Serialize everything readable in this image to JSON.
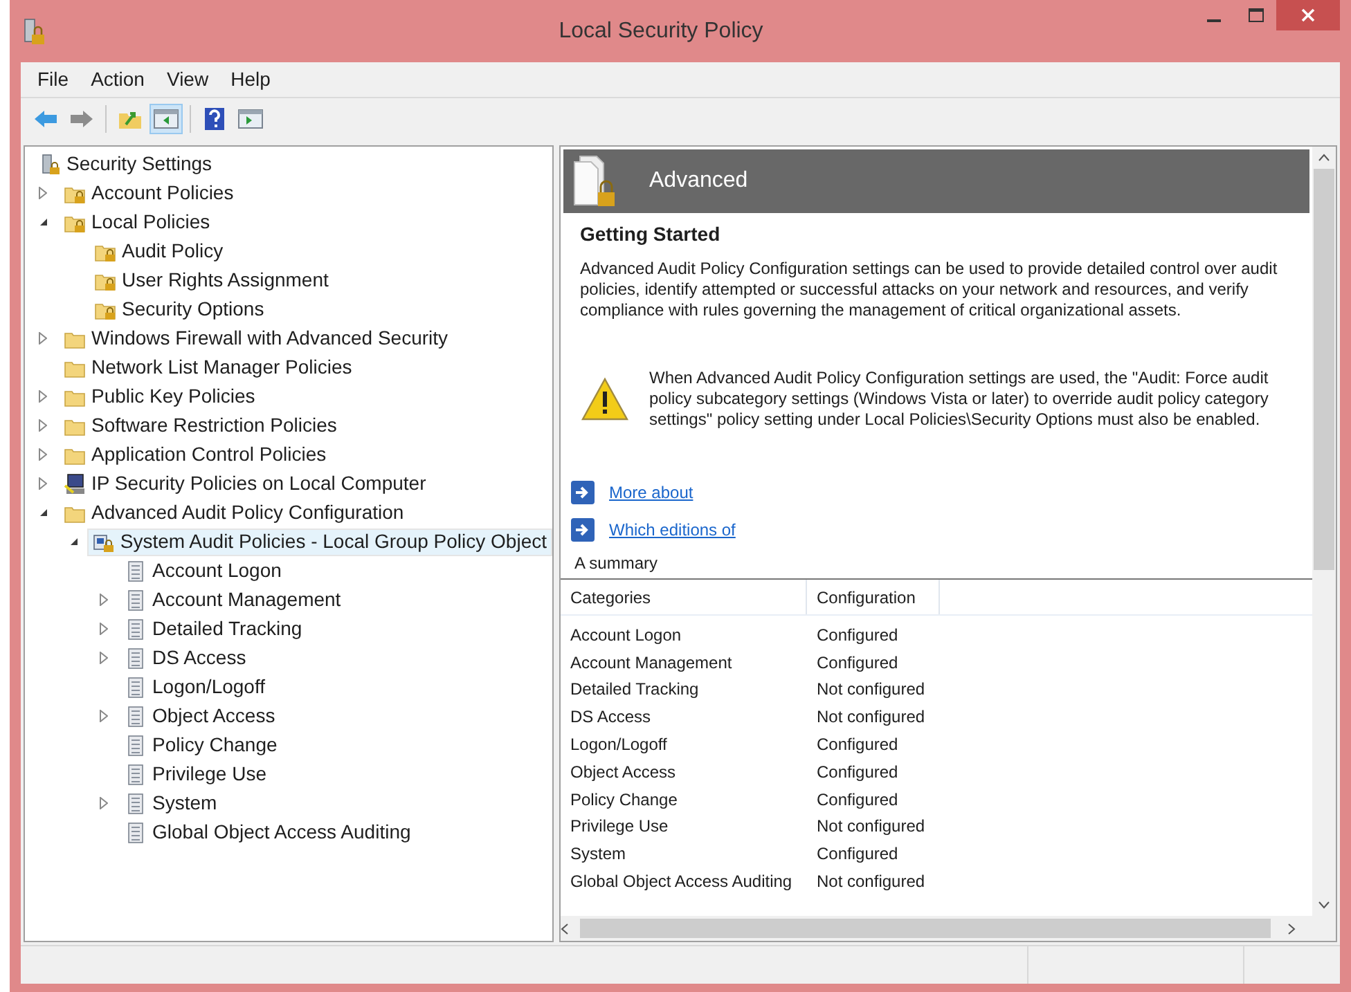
{
  "window": {
    "title": "Local Security Policy"
  },
  "menu": [
    "File",
    "Action",
    "View",
    "Help"
  ],
  "toolbar": [
    {
      "kind": "back",
      "selected": false
    },
    {
      "kind": "forward",
      "selected": false
    },
    {
      "kind": "up",
      "selected": false
    },
    {
      "kind": "pane",
      "selected": true
    },
    {
      "kind": "help",
      "selected": false
    },
    {
      "kind": "action-pane",
      "selected": false
    }
  ],
  "tree": [
    {
      "label": "Security Settings",
      "kind": "root",
      "selected": false,
      "children": [
        {
          "label": "Account Policies",
          "kind": "lock-folder",
          "expanded": false,
          "selected": false
        },
        {
          "label": "Local Policies",
          "kind": "lock-folder",
          "expanded": true,
          "selected": false,
          "children": [
            {
              "label": "Audit Policy",
              "kind": "lock-folder",
              "selected": false
            },
            {
              "label": "User Rights Assignment",
              "kind": "lock-folder",
              "selected": false
            },
            {
              "label": "Security Options",
              "kind": "lock-folder",
              "selected": false
            }
          ]
        },
        {
          "label": "Windows Firewall with Advanced Security",
          "kind": "folder",
          "expanded": false,
          "selected": false
        },
        {
          "label": "Network List Manager Policies",
          "kind": "folder",
          "selected": false
        },
        {
          "label": "Public Key Policies",
          "kind": "folder",
          "expanded": false,
          "selected": false
        },
        {
          "label": "Software Restriction Policies",
          "kind": "folder",
          "expanded": false,
          "selected": false
        },
        {
          "label": "Application Control Policies",
          "kind": "folder",
          "expanded": false,
          "selected": false
        },
        {
          "label": "IP Security Policies on Local Computer",
          "kind": "network",
          "expanded": false,
          "selected": false
        },
        {
          "label": "Advanced Audit Policy Configuration",
          "kind": "folder",
          "expanded": true,
          "selected": false,
          "children": [
            {
              "label": "System Audit Policies - Local Group Policy Object",
              "kind": "gpo",
              "expanded": true,
              "selected": true,
              "children": [
                {
                  "label": "Account Logon",
                  "kind": "policy",
                  "selected": false
                },
                {
                  "label": "Account Management",
                  "kind": "policy",
                  "expanded": false,
                  "selected": false
                },
                {
                  "label": "Detailed Tracking",
                  "kind": "policy",
                  "expanded": false,
                  "selected": false
                },
                {
                  "label": "DS Access",
                  "kind": "policy",
                  "expanded": false,
                  "selected": false
                },
                {
                  "label": "Logon/Logoff",
                  "kind": "policy",
                  "selected": false
                },
                {
                  "label": "Object Access",
                  "kind": "policy",
                  "expanded": false,
                  "selected": false
                },
                {
                  "label": "Policy Change",
                  "kind": "policy",
                  "selected": false
                },
                {
                  "label": "Privilege Use",
                  "kind": "policy",
                  "selected": false
                },
                {
                  "label": "System",
                  "kind": "policy",
                  "expanded": false,
                  "selected": false
                },
                {
                  "label": "Global Object Access Auditing",
                  "kind": "policy",
                  "selected": false
                }
              ]
            }
          ]
        }
      ]
    }
  ],
  "details": {
    "header": "Advanced",
    "heading": "Getting Started",
    "intro": "Advanced Audit Policy Configuration settings can be used to provide detailed control over audit policies, identify attempted or successful attacks on your network and resources, and verify compliance with rules governing the management of critical organizational assets.",
    "warning": "When Advanced Audit Policy Configuration settings are used, the \"Audit: Force audit policy subcategory settings (Windows Vista or later) to override audit policy category settings\" policy setting under Local Policies\\Security Options must also be enabled.",
    "links": [
      "More about",
      "Which editions of"
    ],
    "summary": "A summary",
    "table": {
      "columns": [
        "Categories",
        "Configuration"
      ],
      "rows": [
        [
          "Account Logon",
          "Configured"
        ],
        [
          "Account Management",
          "Configured"
        ],
        [
          "Detailed Tracking",
          "Not configured"
        ],
        [
          "DS Access",
          "Not configured"
        ],
        [
          "Logon/Logoff",
          "Configured"
        ],
        [
          "Object Access",
          "Configured"
        ],
        [
          "Policy Change",
          "Configured"
        ],
        [
          "Privilege Use",
          "Not configured"
        ],
        [
          "System",
          "Configured"
        ],
        [
          "Global Object Access Auditing",
          "Not configured"
        ]
      ]
    }
  }
}
